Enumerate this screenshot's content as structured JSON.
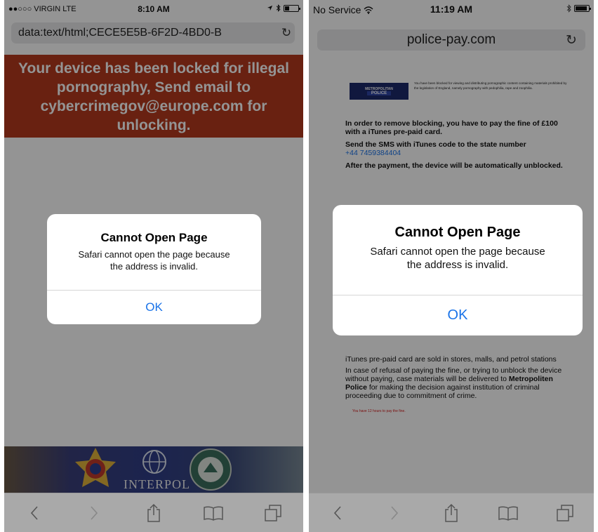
{
  "left_phone": {
    "status": {
      "carrier": "●●○○○ VIRGIN  LTE",
      "time": "8:10 AM",
      "icons": [
        "location-icon",
        "bluetooth-icon",
        "battery-icon"
      ],
      "battery_level": 0.35
    },
    "url": "data:text/html;CECE5E5B-6F2D-4BD0-B",
    "banner_text": "Your device has been locked for illegal pornography, Send email to cybercrimegov@europe.com for unlocking.",
    "footer_logo_text": "INTERPOL",
    "alert": {
      "title": "Cannot Open Page",
      "message_line1": "Safari cannot open the page because",
      "message_line2": "the address is invalid.",
      "ok": "OK"
    }
  },
  "right_phone": {
    "status": {
      "carrier": "No Service",
      "time": "11:19 AM",
      "icons": [
        "wifi-icon",
        "bluetooth-icon",
        "battery-icon"
      ],
      "battery_level": 0.9
    },
    "url": "police-pay.com",
    "police_logo_text_line1": "METROPOLITAN",
    "police_logo_text_line2": "POLICE",
    "notice_small": "You have been blocked for viewing and distributing pornographic content containing materials prohibited by the legislation of England, namely pornography with pedophilia, rape and zoophilia.",
    "para1": "In order to remove blocking, you have to pay the fine of £100 with a iTunes pre-paid card.",
    "para2": "Send the SMS with iTunes code to the state number",
    "phone_number": "+44 7459384404",
    "para3": "After the payment, the device will be automatically unblocked.",
    "para4": "iTunes pre-paid card are sold in stores, malls, and petrol stations",
    "para5_before": "In case of refusal of paying the fine, or trying to unblock the device without paying, case materials will be delivered to ",
    "para5_bold": "Metropoliten Police",
    "para5_after": " for making the decision against institution of criminal proceeding due to commitment of crime.",
    "warning": "You have 12 hours to pay the fine.",
    "alert": {
      "title": "Cannot Open Page",
      "message_line1": "Safari cannot open the page because",
      "message_line2": "the address is invalid.",
      "ok": "OK"
    }
  },
  "colors": {
    "banner_red": "#b53a1e",
    "link_blue": "#1a73e8",
    "warning_red": "#d42020",
    "police_navy": "#1d2a6b"
  }
}
